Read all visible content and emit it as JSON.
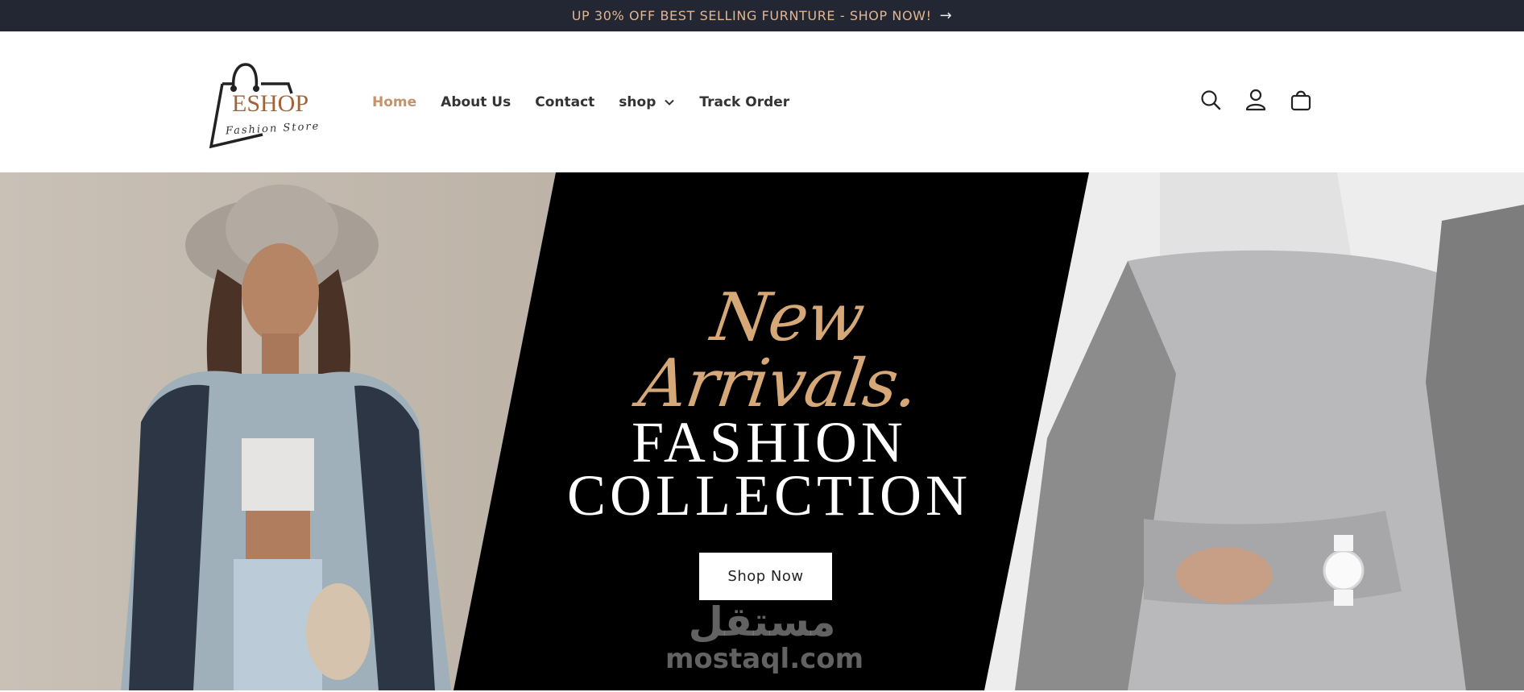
{
  "announcement": {
    "text": "UP 30% OFF BEST SELLING FURNTURE - SHOP NOW!",
    "arrow_icon": "arrow-right-icon"
  },
  "logo": {
    "brand": "ESHOP",
    "tagline": "Fashion Store",
    "brand_color": "#a0643a"
  },
  "nav": {
    "items": [
      {
        "label": "Home",
        "active": true
      },
      {
        "label": "About Us"
      },
      {
        "label": "Contact"
      },
      {
        "label": "shop",
        "dropdown": true
      },
      {
        "label": "Track Order"
      }
    ],
    "active_color": "#c4936a"
  },
  "header_icons": [
    "search-icon",
    "account-icon",
    "cart-icon"
  ],
  "hero": {
    "tagline": "New Arrivals.",
    "title_line1": "FASHION",
    "title_line2": "COLLECTION",
    "button_label": "Shop Now",
    "accent_color": "#d6a878"
  },
  "watermark": {
    "arabic": "مستقل",
    "latin": "mostaql.com"
  }
}
